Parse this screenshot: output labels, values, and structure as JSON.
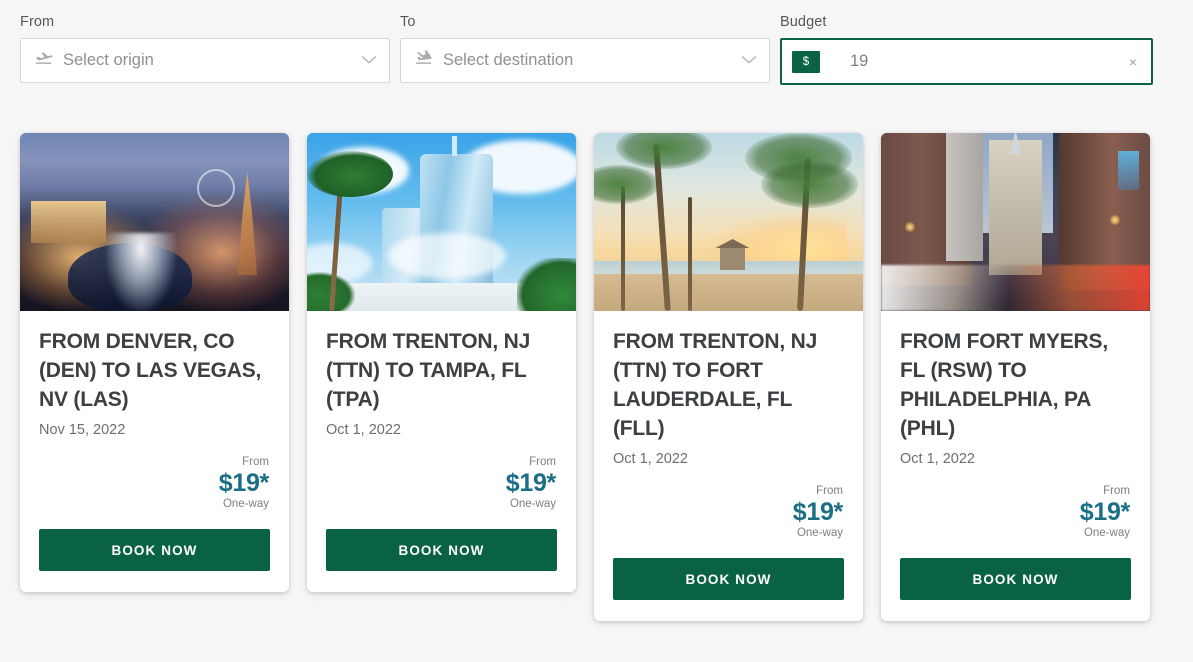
{
  "search": {
    "from": {
      "label": "From",
      "placeholder": "Select origin",
      "value": "",
      "icon": "plane-departure-icon"
    },
    "to": {
      "label": "To",
      "placeholder": "Select destination",
      "value": "",
      "icon": "plane-arrival-icon"
    },
    "budget": {
      "label": "Budget",
      "currency_symbol": "$",
      "value": "19",
      "placeholder": "",
      "clear_label": "×",
      "focused_border_color": "#0b6346",
      "badge_color": "#0b6346"
    }
  },
  "theme": {
    "page_background": "#f6f6f6",
    "card_background": "#ffffff",
    "cta_green": "#0a6245",
    "price_teal": "#1a6f87",
    "title_gray": "#3c4043",
    "muted_gray": "#6a6f73"
  },
  "deals": [
    {
      "title": "FROM DENVER, CO (DEN) TO LAS VEGAS, NV (LAS)",
      "date": "Nov 15, 2022",
      "price_from_label": "From",
      "price": "$19*",
      "price_oneway_label": "One-way",
      "cta": "BOOK NOW",
      "photo_alt": "Las Vegas Strip at dusk with Bellagio fountains",
      "photo_style": "art-vegas"
    },
    {
      "title": "FROM TRENTON, NJ (TTN) TO TAMPA, FL (TPA)",
      "date": "Oct 1, 2022",
      "price_from_label": "From",
      "price": "$19*",
      "price_oneway_label": "One-way",
      "cta": "BOOK NOW",
      "photo_alt": "Tampa glass high-rise towers with palm tree and blue sky",
      "photo_style": "art-tampa"
    },
    {
      "title": "FROM TRENTON, NJ (TTN) TO FORT LAUDERDALE, FL (FLL)",
      "date": "Oct 1, 2022",
      "price_from_label": "From",
      "price": "$19*",
      "price_oneway_label": "One-way",
      "cta": "BOOK NOW",
      "photo_alt": "Fort Lauderdale beach at sunset with palm trees and lifeguard hut",
      "photo_style": "art-fll"
    },
    {
      "title": "FROM FORT MYERS, FL (RSW) TO PHILADELPHIA, PA (PHL)",
      "date": "Oct 1, 2022",
      "price_from_label": "From",
      "price": "$19*",
      "price_oneway_label": "One-way",
      "cta": "BOOK NOW",
      "photo_alt": "Philadelphia City Hall at night with car light trails",
      "photo_style": "art-phl"
    }
  ]
}
